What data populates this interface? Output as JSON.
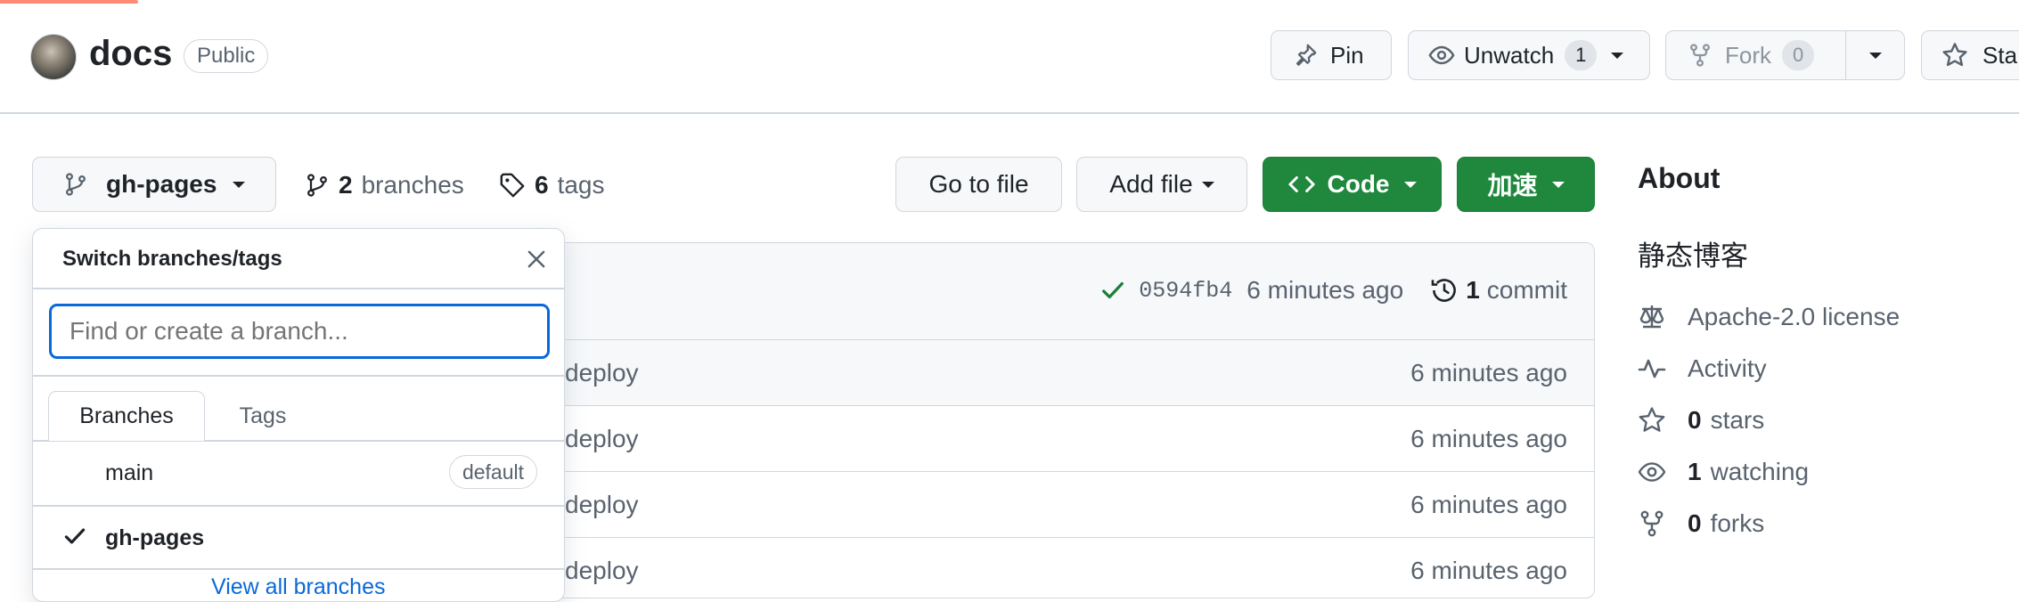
{
  "repo": {
    "name": "docs",
    "visibility": "Public"
  },
  "header_actions": {
    "pin_label": "Pin",
    "unwatch_label": "Unwatch",
    "unwatch_count": "1",
    "fork_label": "Fork",
    "fork_count": "0",
    "star_label": "Sta"
  },
  "toolbar": {
    "branch_name": "gh-pages",
    "branches_count": "2",
    "branches_label": "branches",
    "tags_count": "6",
    "tags_label": "tags",
    "go_to_file": "Go to file",
    "add_file": "Add file",
    "code": "Code",
    "accelerate": "加速"
  },
  "commit_bar": {
    "hash": "0594fb4",
    "time": "6 minutes ago",
    "commits_count": "1",
    "commits_label": "commit"
  },
  "files": [
    {
      "message": "deploy",
      "time": "6 minutes ago"
    },
    {
      "message": "deploy",
      "time": "6 minutes ago"
    },
    {
      "message": "deploy",
      "time": "6 minutes ago"
    },
    {
      "message": "deploy",
      "time": "6 minutes ago"
    }
  ],
  "dropdown": {
    "title": "Switch branches/tags",
    "search_placeholder": "Find or create a branch...",
    "tabs": [
      "Branches",
      "Tags"
    ],
    "branches": [
      {
        "name": "main",
        "badge": "default",
        "selected": false
      },
      {
        "name": "gh-pages",
        "badge": "",
        "selected": true
      }
    ],
    "view_all": "View all branches"
  },
  "about": {
    "heading": "About",
    "description": "静态博客",
    "license": "Apache-2.0 license",
    "activity": "Activity",
    "stars_count": "0",
    "stars_label": "stars",
    "watching_count": "1",
    "watching_label": "watching",
    "forks_count": "0",
    "forks_label": "forks"
  },
  "colors": {
    "primary_green": "#1f883d",
    "link_blue": "#0969da",
    "border": "#d0d7de",
    "progress_orange": "#fd8c73"
  }
}
